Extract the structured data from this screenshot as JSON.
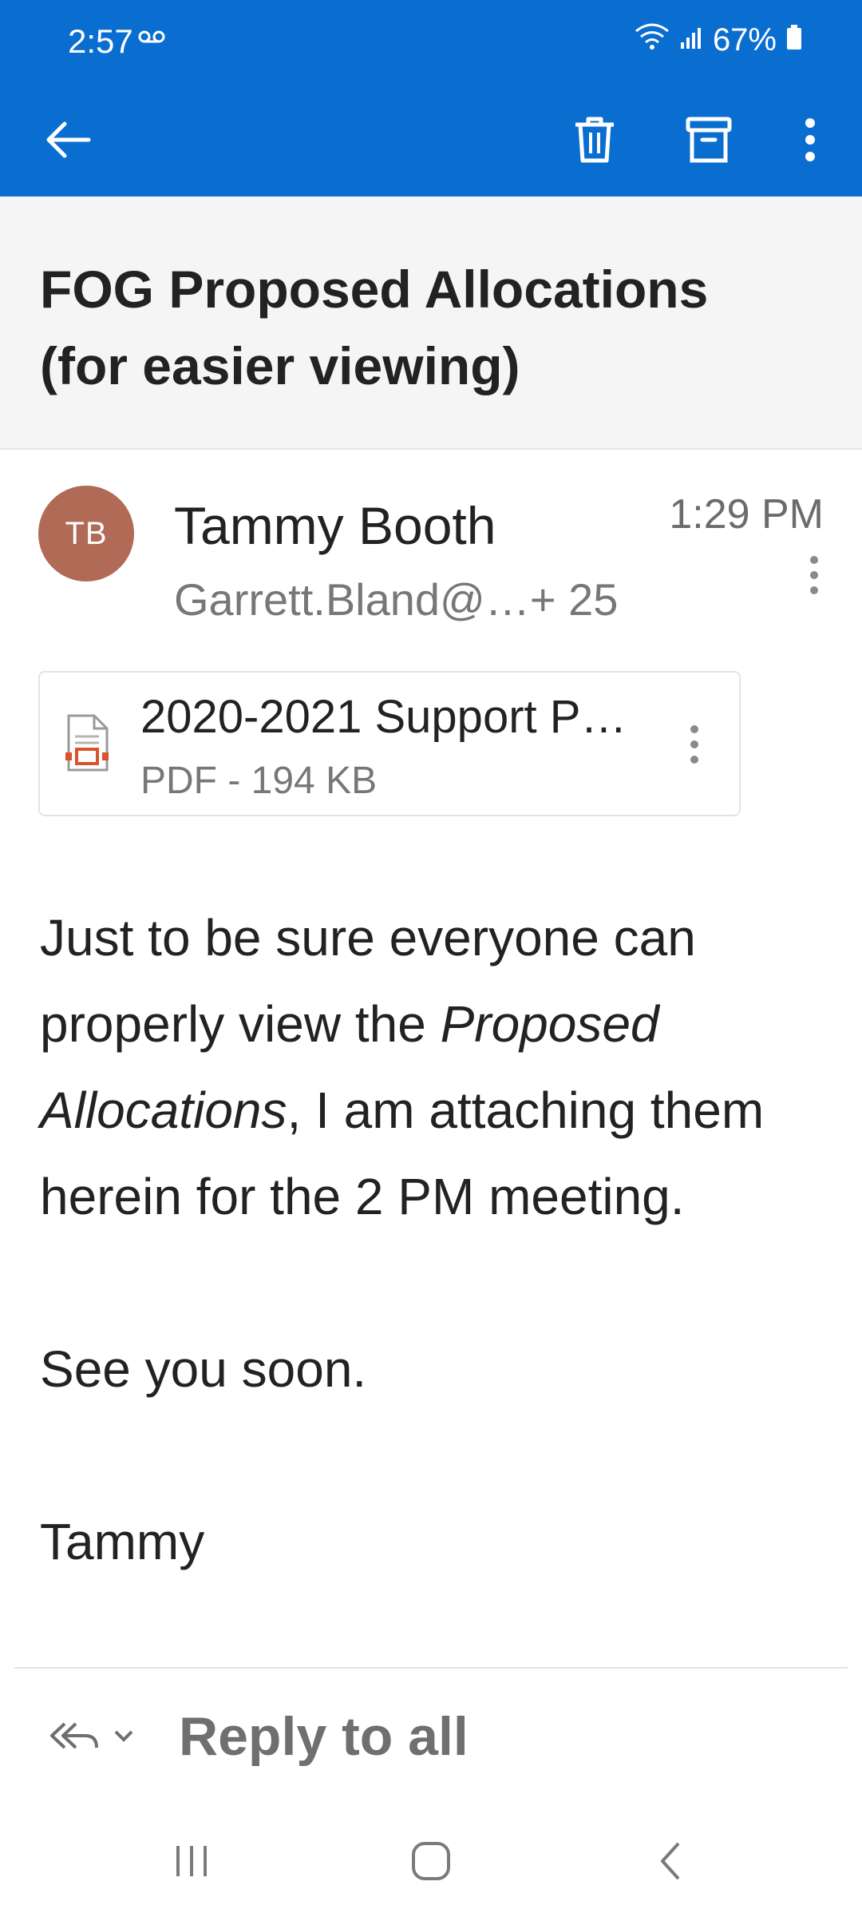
{
  "status": {
    "time": "2:57",
    "battery": "67%"
  },
  "subject": "FOG Proposed Allocations (for easier viewing)",
  "sender": {
    "initials": "TB",
    "name": "Tammy Booth",
    "recipients": "Garrett.Bland@…+ 25",
    "time": "1:29 PM"
  },
  "attachment": {
    "name": "2020-2021 Support P…",
    "meta": "PDF - 194 KB"
  },
  "body": {
    "p1_start": "Just to be sure everyone can properly view the ",
    "p1_em": "Proposed Allocations",
    "p1_end": ", I am attaching them herein for the 2 PM meeting.",
    "p2": "See you soon.",
    "p3": "Tammy"
  },
  "reply": {
    "label": "Reply to all"
  },
  "colors": {
    "brand": "#0a6ed1",
    "avatar": "#b06a55",
    "pdf_accent": "#d9532c"
  }
}
